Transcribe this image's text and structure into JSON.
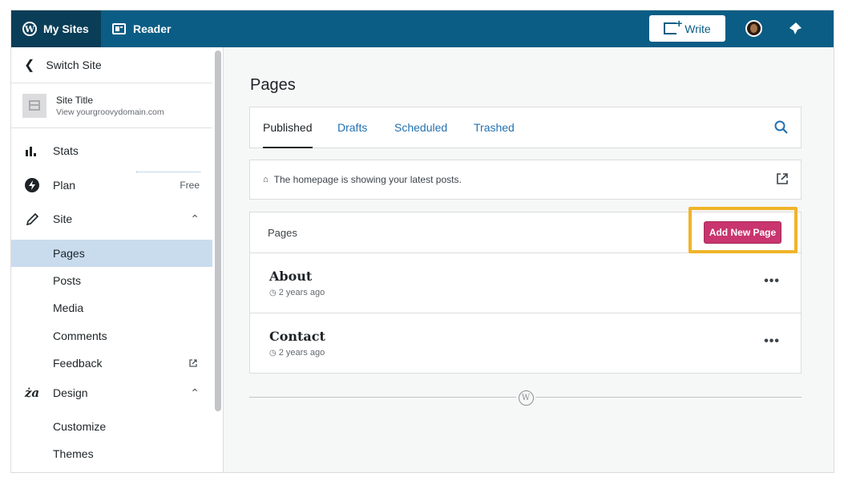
{
  "topbar": {
    "my_sites_label": "My Sites",
    "reader_label": "Reader",
    "write_label": "Write",
    "colors": {
      "bar": "#0b5d85",
      "active": "#0a3d57"
    }
  },
  "sidebar": {
    "switch_site_label": "Switch Site",
    "site_title": "Site Title",
    "site_url": "View yourgroovydomain.com",
    "items": [
      {
        "label": "Stats",
        "icon": "stats-icon"
      },
      {
        "label": "Plan",
        "icon": "plan-icon",
        "badge": "Free"
      },
      {
        "label": "Site",
        "icon": "pencil-icon"
      },
      {
        "label": "Design",
        "icon": "design-icon"
      }
    ],
    "site_sub": [
      "Pages",
      "Posts",
      "Media",
      "Comments",
      "Feedback"
    ],
    "design_sub": [
      "Customize",
      "Themes"
    ],
    "active_item": "Pages"
  },
  "main": {
    "title": "Pages",
    "tabs": [
      "Published",
      "Drafts",
      "Scheduled",
      "Trashed"
    ],
    "active_tab": "Published",
    "notice": "The homepage is showing your latest posts.",
    "list_header": "Pages",
    "add_button": "Add New Page",
    "pages": [
      {
        "title": "About",
        "time": "2 years ago"
      },
      {
        "title": "Contact",
        "time": "2 years ago"
      }
    ],
    "accent_color": "#c9356e",
    "highlight_color": "#f0b429"
  }
}
